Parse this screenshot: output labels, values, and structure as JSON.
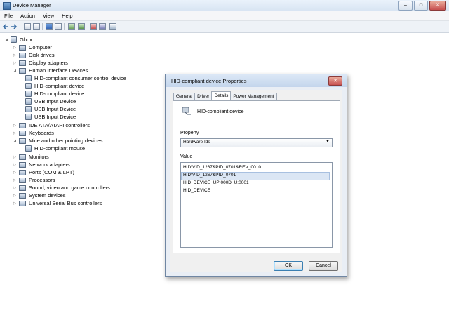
{
  "window": {
    "title": "Device Manager",
    "buttons": {
      "minimize": "–",
      "maximize": "□",
      "close": "✕"
    }
  },
  "menu": [
    "File",
    "Action",
    "View",
    "Help"
  ],
  "tree": {
    "root": "Gbox",
    "items": [
      {
        "label": "Computer",
        "expander": "▷",
        "icon": "computer-icon"
      },
      {
        "label": "Disk drives",
        "expander": "▷",
        "icon": "disk-drive-icon"
      },
      {
        "label": "Display adapters",
        "expander": "▷",
        "icon": "display-adapter-icon"
      },
      {
        "label": "Human Interface Devices",
        "expander": "◢",
        "icon": "hid-icon",
        "children": [
          "HID-compliant consumer control device",
          "HID-compliant device",
          "HID-compliant device",
          "USB Input Device",
          "USB Input Device",
          "USB Input Device"
        ]
      },
      {
        "label": "IDE ATA/ATAPI controllers",
        "expander": "▷",
        "icon": "ide-controller-icon"
      },
      {
        "label": "Keyboards",
        "expander": "▷",
        "icon": "keyboard-icon"
      },
      {
        "label": "Mice and other pointing devices",
        "expander": "◢",
        "icon": "mouse-icon",
        "children": [
          "HID-compliant mouse"
        ]
      },
      {
        "label": "Monitors",
        "expander": "▷",
        "icon": "monitor-icon"
      },
      {
        "label": "Network adapters",
        "expander": "▷",
        "icon": "network-adapter-icon"
      },
      {
        "label": "Ports (COM & LPT)",
        "expander": "▷",
        "icon": "port-icon"
      },
      {
        "label": "Processors",
        "expander": "▷",
        "icon": "processor-icon"
      },
      {
        "label": "Sound, video and game controllers",
        "expander": "▷",
        "icon": "sound-icon"
      },
      {
        "label": "System devices",
        "expander": "▷",
        "icon": "system-device-icon"
      },
      {
        "label": "Universal Serial Bus controllers",
        "expander": "▷",
        "icon": "usb-icon"
      }
    ]
  },
  "dialog": {
    "title": "HID-compliant device Properties",
    "close": "✕",
    "tabs": [
      "General",
      "Driver",
      "Details",
      "Power Management"
    ],
    "active_tab": "Details",
    "device_name": "HID-compliant device",
    "property_label": "Property",
    "property_value": "Hardware Ids",
    "value_label": "Value",
    "values": [
      "HID\\VID_1267&PID_0701&REV_0010",
      "HID\\VID_1267&PID_0701",
      "HID_DEVICE_UP:000D_U:0001",
      "HID_DEVICE"
    ],
    "selected_value_index": 1,
    "ok": "OK",
    "cancel": "Cancel"
  }
}
